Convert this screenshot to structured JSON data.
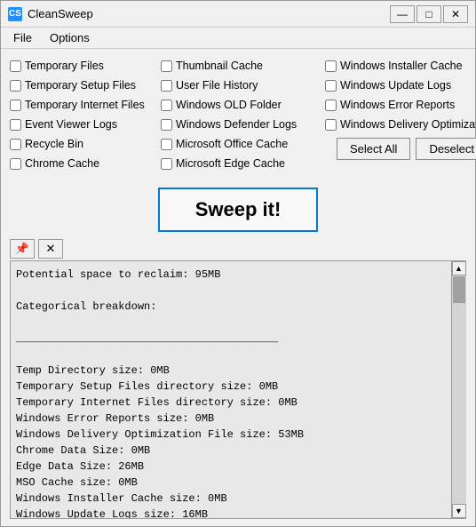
{
  "window": {
    "title": "CleanSweep",
    "icon": "CS",
    "controls": {
      "minimize": "—",
      "maximize": "□",
      "close": "✕"
    }
  },
  "menu": {
    "file": "File",
    "options": "Options"
  },
  "checkboxes": {
    "col1": [
      "Temporary Files",
      "Temporary Setup Files",
      "Temporary Internet Files",
      "Event Viewer Logs",
      "Recycle Bin",
      "Chrome Cache"
    ],
    "col2": [
      "Thumbnail Cache",
      "User File History",
      "Windows OLD Folder",
      "Windows Defender Logs",
      "Microsoft Office Cache",
      "Microsoft Edge Cache"
    ],
    "col3": [
      "Windows Installer Cache",
      "Windows Update Logs",
      "Windows Error Reports",
      "Windows Delivery Optimizat..."
    ]
  },
  "buttons": {
    "select_all": "Select All",
    "deselect": "Deselect"
  },
  "sweep_button": "Sweep it!",
  "log_toolbar": {
    "pin": "📌",
    "close": "✕"
  },
  "log_content": "Potential space to reclaim: 95MB\n\nCategorical breakdown:\n\n_________________________________________\n\nTemp Directory size: 0MB\nTemporary Setup Files directory size: 0MB\nTemporary Internet Files directory size: 0MB\nWindows Error Reports size: 0MB\nWindows Delivery Optimization File size: 53MB\nChrome Data Size: 0MB\nEdge Data Size: 26MB\nMSO Cache size: 0MB\nWindows Installer Cache size: 0MB\nWindows Update Logs size: 16MB"
}
